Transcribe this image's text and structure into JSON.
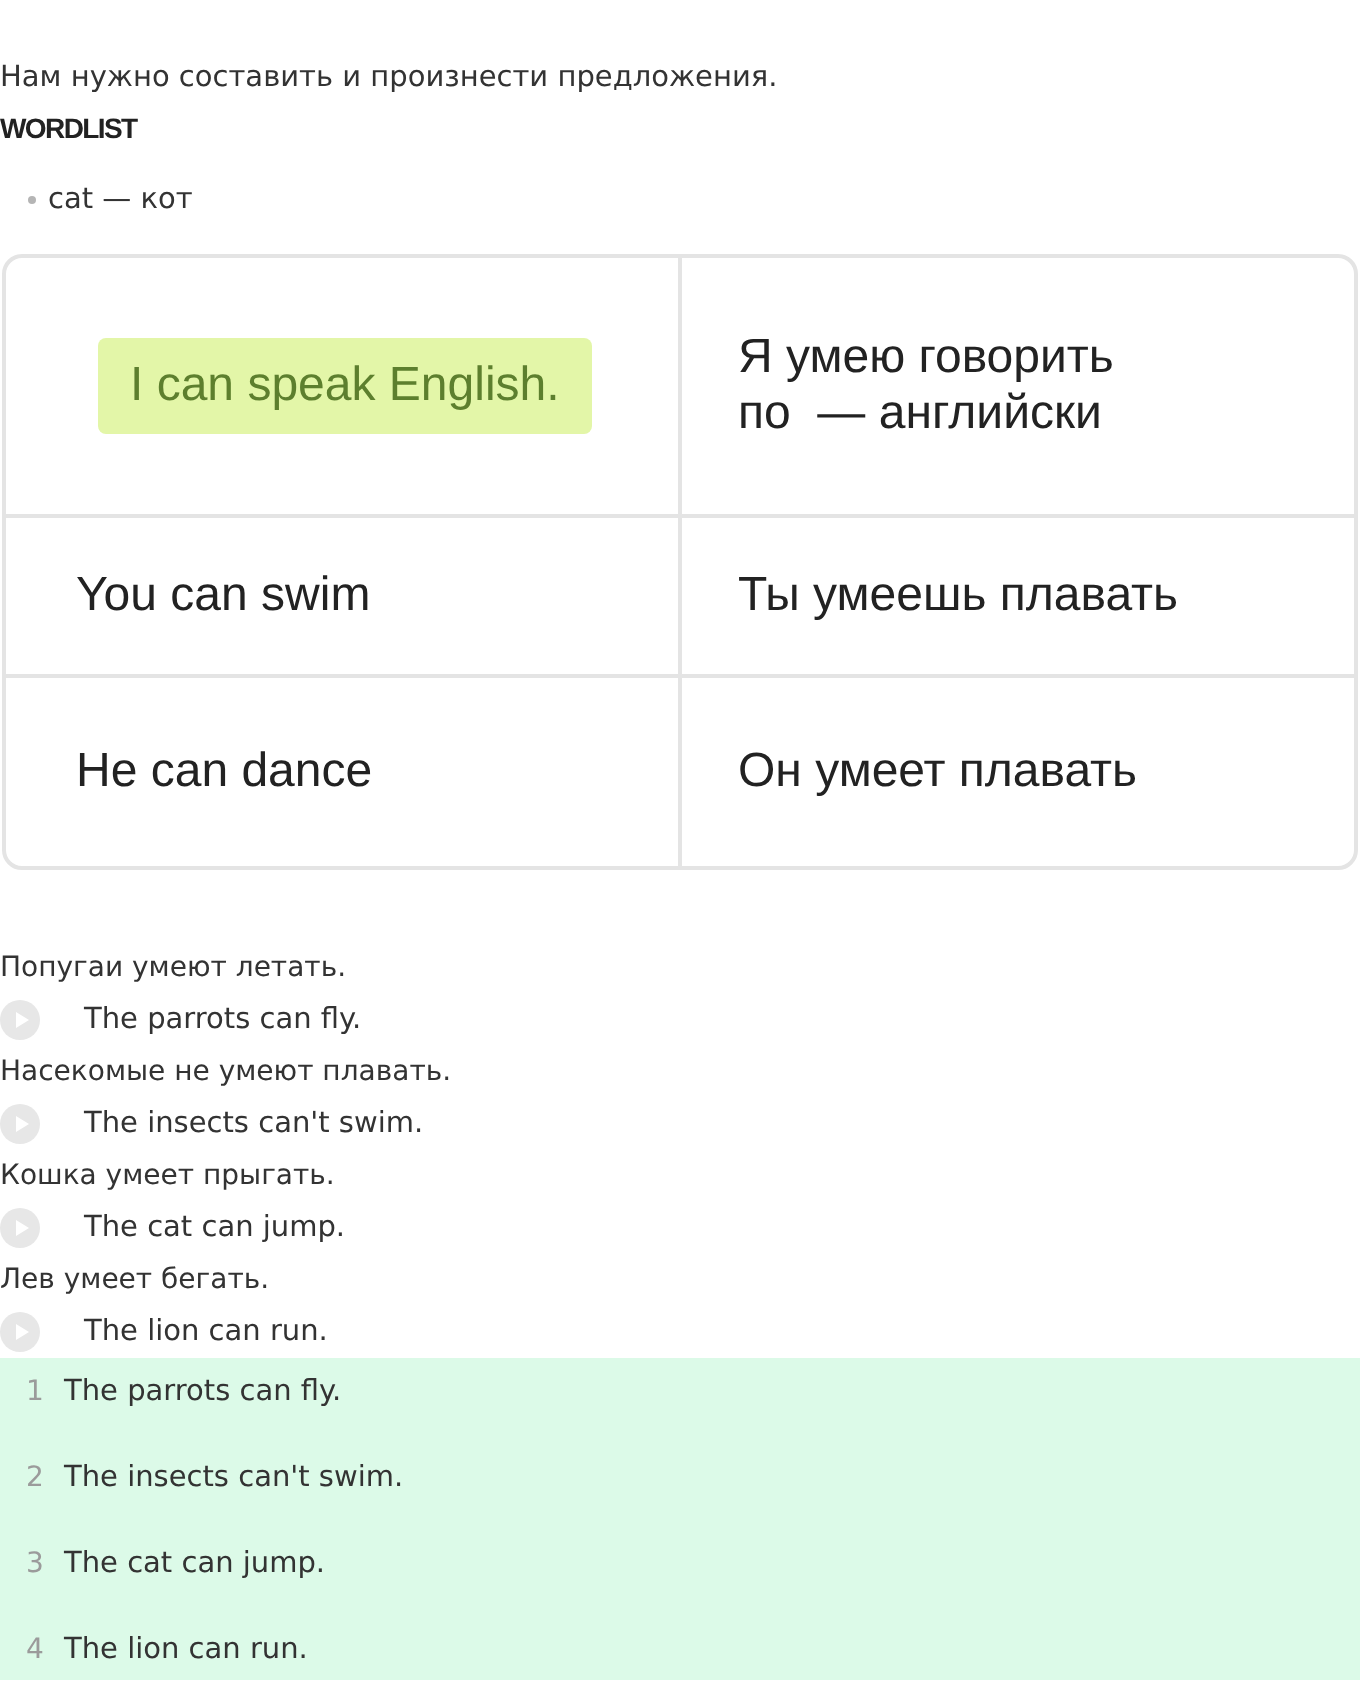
{
  "intro": "Нам нужно составить и произнести предложения.",
  "wordlist": {
    "title": "WORDLIST",
    "items": [
      "cat — кот"
    ]
  },
  "table": {
    "rows": [
      {
        "english": {
          "text": "I can speak English.",
          "highlighted": true
        },
        "russian": "Я умею говорить\nпо  — английски"
      },
      {
        "english": {
          "text": "You can swim",
          "highlighted": false
        },
        "russian": "Ты умеешь плавать"
      },
      {
        "english": {
          "text": "He can dance",
          "highlighted": false
        },
        "russian": "Он умеет плавать"
      }
    ]
  },
  "sentences": [
    {
      "russian": "Попугаи умеют летать.",
      "english": "The parrots can fly."
    },
    {
      "russian": "Насекомые не умеют плавать.",
      "english": "The insects can't swim."
    },
    {
      "russian": "Кошка умеет прыгать.",
      "english": "The cat can jump."
    },
    {
      "russian": "Лев умеет бегать.",
      "english": "The lion can run."
    }
  ],
  "answers": [
    {
      "number": "1",
      "text": "The parrots can fly."
    },
    {
      "number": "2",
      "text": "The insects can't swim."
    },
    {
      "number": "3",
      "text": "The cat can jump."
    },
    {
      "number": "4",
      "text": "The lion can run."
    }
  ]
}
